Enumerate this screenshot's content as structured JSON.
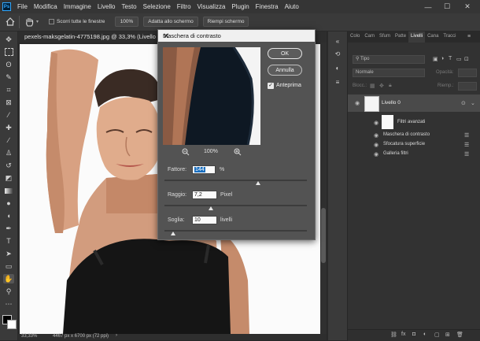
{
  "menubar": {
    "logo": "Ps",
    "items": [
      "File",
      "Modifica",
      "Immagine",
      "Livello",
      "Testo",
      "Selezione",
      "Filtro",
      "Visualizza",
      "Plugin",
      "Finestra",
      "Aiuto"
    ],
    "controls": {
      "minimize": "—",
      "maximize": "☐",
      "close": "✕"
    }
  },
  "optionsbar": {
    "scroll_all_label": "Scorri tutte le finestre",
    "zoom_value": "100%",
    "fit_screen": "Adatta allo schermo",
    "fill_screen": "Riempi schermo"
  },
  "document": {
    "tab_title": "pexels-maksgelatin-4775198.jpg @ 33,3% (Livello 0, R",
    "zoom_status": "33,33%",
    "size_status": "4467 px x 6700 px (72 ppi)"
  },
  "dialog": {
    "title": "Maschera di contrasto",
    "ok": "OK",
    "cancel": "Annulla",
    "preview_label": "Anteprima",
    "preview_checked": true,
    "preview_zoom": "100%",
    "amount_label": "Fattore:",
    "amount_value": "144",
    "amount_unit": "%",
    "radius_label": "Raggio:",
    "radius_value": "7,2",
    "radius_unit": "Pixel",
    "threshold_label": "Soglia:",
    "threshold_value": "10",
    "threshold_unit": "livelli"
  },
  "panel": {
    "tabs": [
      "Colo",
      "Cam",
      "Sfum",
      "Patte",
      "Livelli",
      "Cana",
      "Tracci"
    ],
    "active_tab": "Livelli",
    "filter_kind": "Tipo",
    "blend_mode": "Normale",
    "opacity_label": "Opacità:",
    "lock_label": "Blocc.:",
    "fill_label": "Riemp.:",
    "layer_name": "Livello 0",
    "smart_filters_label": "Filtri avanzati",
    "filters": [
      "Maschera di contrasto",
      "Sfocatura superficie",
      "Galleria filtri"
    ]
  },
  "colors": {
    "accent": "#31a8ff",
    "selection": "#1a6fbf"
  }
}
